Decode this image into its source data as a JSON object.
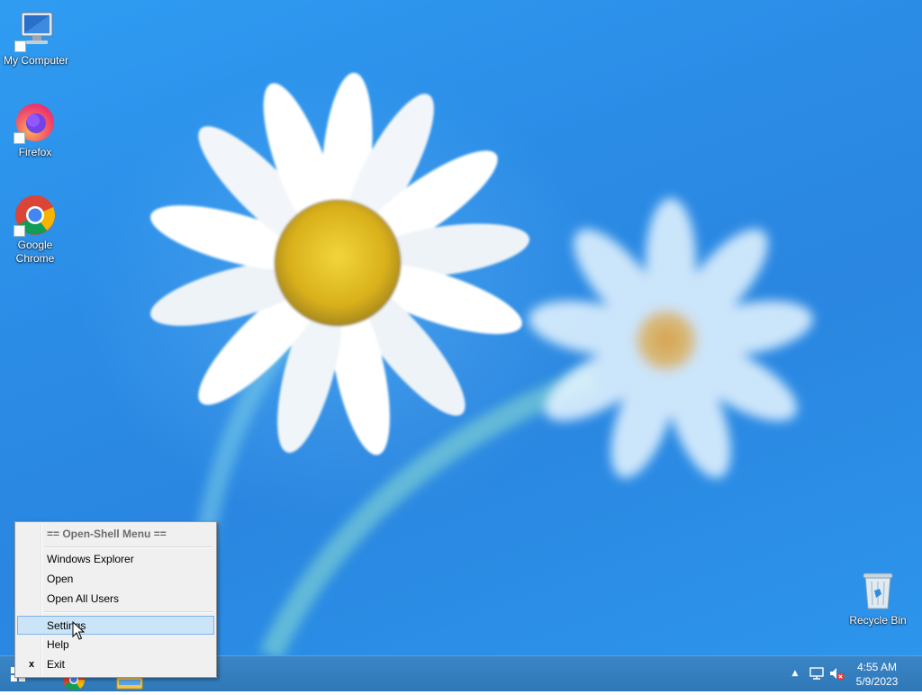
{
  "desktop": {
    "icons": [
      {
        "label_line1": "My Computer",
        "label_line2": "",
        "icon": "my-computer-icon"
      },
      {
        "label_line1": "Firefox",
        "label_line2": "",
        "icon": "firefox-icon"
      },
      {
        "label_line1": "Google",
        "label_line2": "Chrome",
        "icon": "chrome-icon"
      },
      {
        "label_line1": "Recycle Bin",
        "label_line2": "",
        "icon": "recycle-bin-icon"
      }
    ]
  },
  "context_menu": {
    "header": "== Open-Shell Menu ==",
    "items": [
      {
        "label": "Windows Explorer",
        "check": ""
      },
      {
        "label": "Open",
        "check": ""
      },
      {
        "label": "Open All Users",
        "check": ""
      },
      {
        "label": "Settings",
        "check": "",
        "hovered": true
      },
      {
        "label": "Help",
        "check": ""
      },
      {
        "label": "Exit",
        "check": "x"
      }
    ]
  },
  "taskbar": {
    "clock_time": "4:55 AM",
    "clock_date": "5/9/2023",
    "tray_expand_symbol": "▲",
    "buttons": [
      "start-button-icon",
      "chrome-taskbar-icon",
      "file-explorer-taskbar-icon"
    ]
  },
  "colors": {
    "wallpaper": "#2b8ce6",
    "taskbar": "#3a85c6",
    "menu_background": "#f0f0f0",
    "menu_hover": "#cce4f7"
  }
}
